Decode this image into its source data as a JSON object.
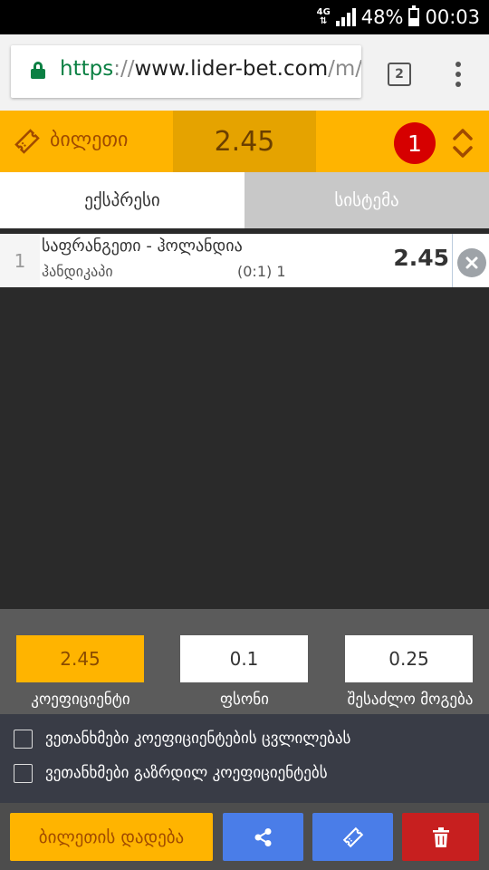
{
  "status_bar": {
    "network": "4G",
    "battery_percent": "48%",
    "time": "00:03"
  },
  "browser": {
    "url_scheme": "https",
    "url_sep": "://",
    "url_host": "www.lider-bet.com",
    "url_path": "/m/",
    "tab_count": "2"
  },
  "ticket": {
    "title": "ბილეთი",
    "total_odds": "2.45",
    "count": "1"
  },
  "tabs": [
    {
      "label": "ექსპრესი"
    },
    {
      "label": "სისტემა"
    }
  ],
  "bets": [
    {
      "index": "1",
      "match": "საფრანგეთი - ჰოლანდია",
      "market": "ჰანდიკაპი",
      "handicap": "(0:1) 1",
      "odds": "2.45"
    }
  ],
  "summary": {
    "odds_value": "2.45",
    "odds_label": "კოეფიციენტი",
    "stake_value": "0.1",
    "stake_label": "ფსონი",
    "win_value": "0.25",
    "win_label": "შესაძლო მოგება"
  },
  "agreements": [
    {
      "label": "ვეთანხმები კოეფიციენტების ცვლილებას"
    },
    {
      "label": "ვეთანხმები გაზრდილ კოეფიციენტებს"
    }
  ],
  "actions": {
    "place_label": "ბილეთის დადება"
  },
  "colors": {
    "accent": "#ffb400",
    "share_blue": "#4a7de8",
    "delete_red": "#c71f1f"
  }
}
